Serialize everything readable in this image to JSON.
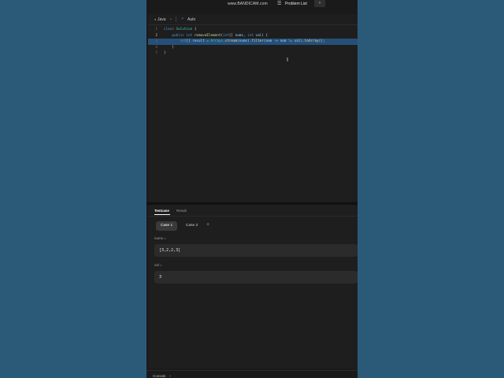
{
  "header": {
    "watermark": "www.BANDICAM.com",
    "menu_icon": "menu-icon",
    "problem_list": "Problem List",
    "next_glyph": "›"
  },
  "editor": {
    "language": "Java",
    "mode": "Auto",
    "lines": [
      {
        "num": "1",
        "segments": [
          [
            "kw",
            "class "
          ],
          [
            "ty",
            "Solution "
          ],
          [
            "tx",
            "{"
          ]
        ]
      },
      {
        "num": "2",
        "segments": [
          [
            "tx",
            "    "
          ],
          [
            "kw",
            "public "
          ],
          [
            "kw",
            "int "
          ],
          [
            "fn",
            "removeElement"
          ],
          [
            "tx",
            "("
          ],
          [
            "kw",
            "int"
          ],
          [
            "tx",
            "[] "
          ],
          [
            "pl",
            "nums"
          ],
          [
            "tx",
            ", "
          ],
          [
            "kw",
            "int "
          ],
          [
            "pl",
            "val"
          ],
          [
            "tx",
            ") {"
          ]
        ]
      },
      {
        "num": "3",
        "segments": [
          [
            "tx",
            "        "
          ],
          [
            "kw",
            "int"
          ],
          [
            "tx",
            "[] "
          ],
          [
            "pl",
            "result"
          ],
          [
            "op",
            " = "
          ],
          [
            "ty",
            "Arrays"
          ],
          [
            "tx",
            "."
          ],
          [
            "fn",
            "stream"
          ],
          [
            "tx",
            "("
          ],
          [
            "pl",
            "nums"
          ],
          [
            "tx",
            ")."
          ],
          [
            "fn",
            "filter"
          ],
          [
            "tx",
            "("
          ],
          [
            "pl",
            "num"
          ],
          [
            "op",
            " -> "
          ],
          [
            "pl",
            "num"
          ],
          [
            "op",
            " != "
          ],
          [
            "pl",
            "val"
          ],
          [
            "tx",
            ")."
          ],
          [
            "fn",
            "toArray"
          ],
          [
            "tx",
            "();"
          ]
        ]
      },
      {
        "num": "4",
        "segments": [
          [
            "tx",
            "    }"
          ]
        ]
      },
      {
        "num": "5",
        "segments": [
          [
            "tx",
            "}"
          ]
        ]
      }
    ],
    "active_line": 3
  },
  "testcase": {
    "tabs": [
      "Testcase",
      "Result"
    ],
    "cases": [
      "Case 1",
      "Case 2"
    ],
    "add_case": "+",
    "nums_label": "nums =",
    "nums_value": "[3,2,2,3]",
    "val_label": "val =",
    "val_value": "3"
  },
  "console": {
    "label": "Console"
  },
  "colors": {
    "background": "#2b5a79",
    "selection": "#264f78"
  }
}
